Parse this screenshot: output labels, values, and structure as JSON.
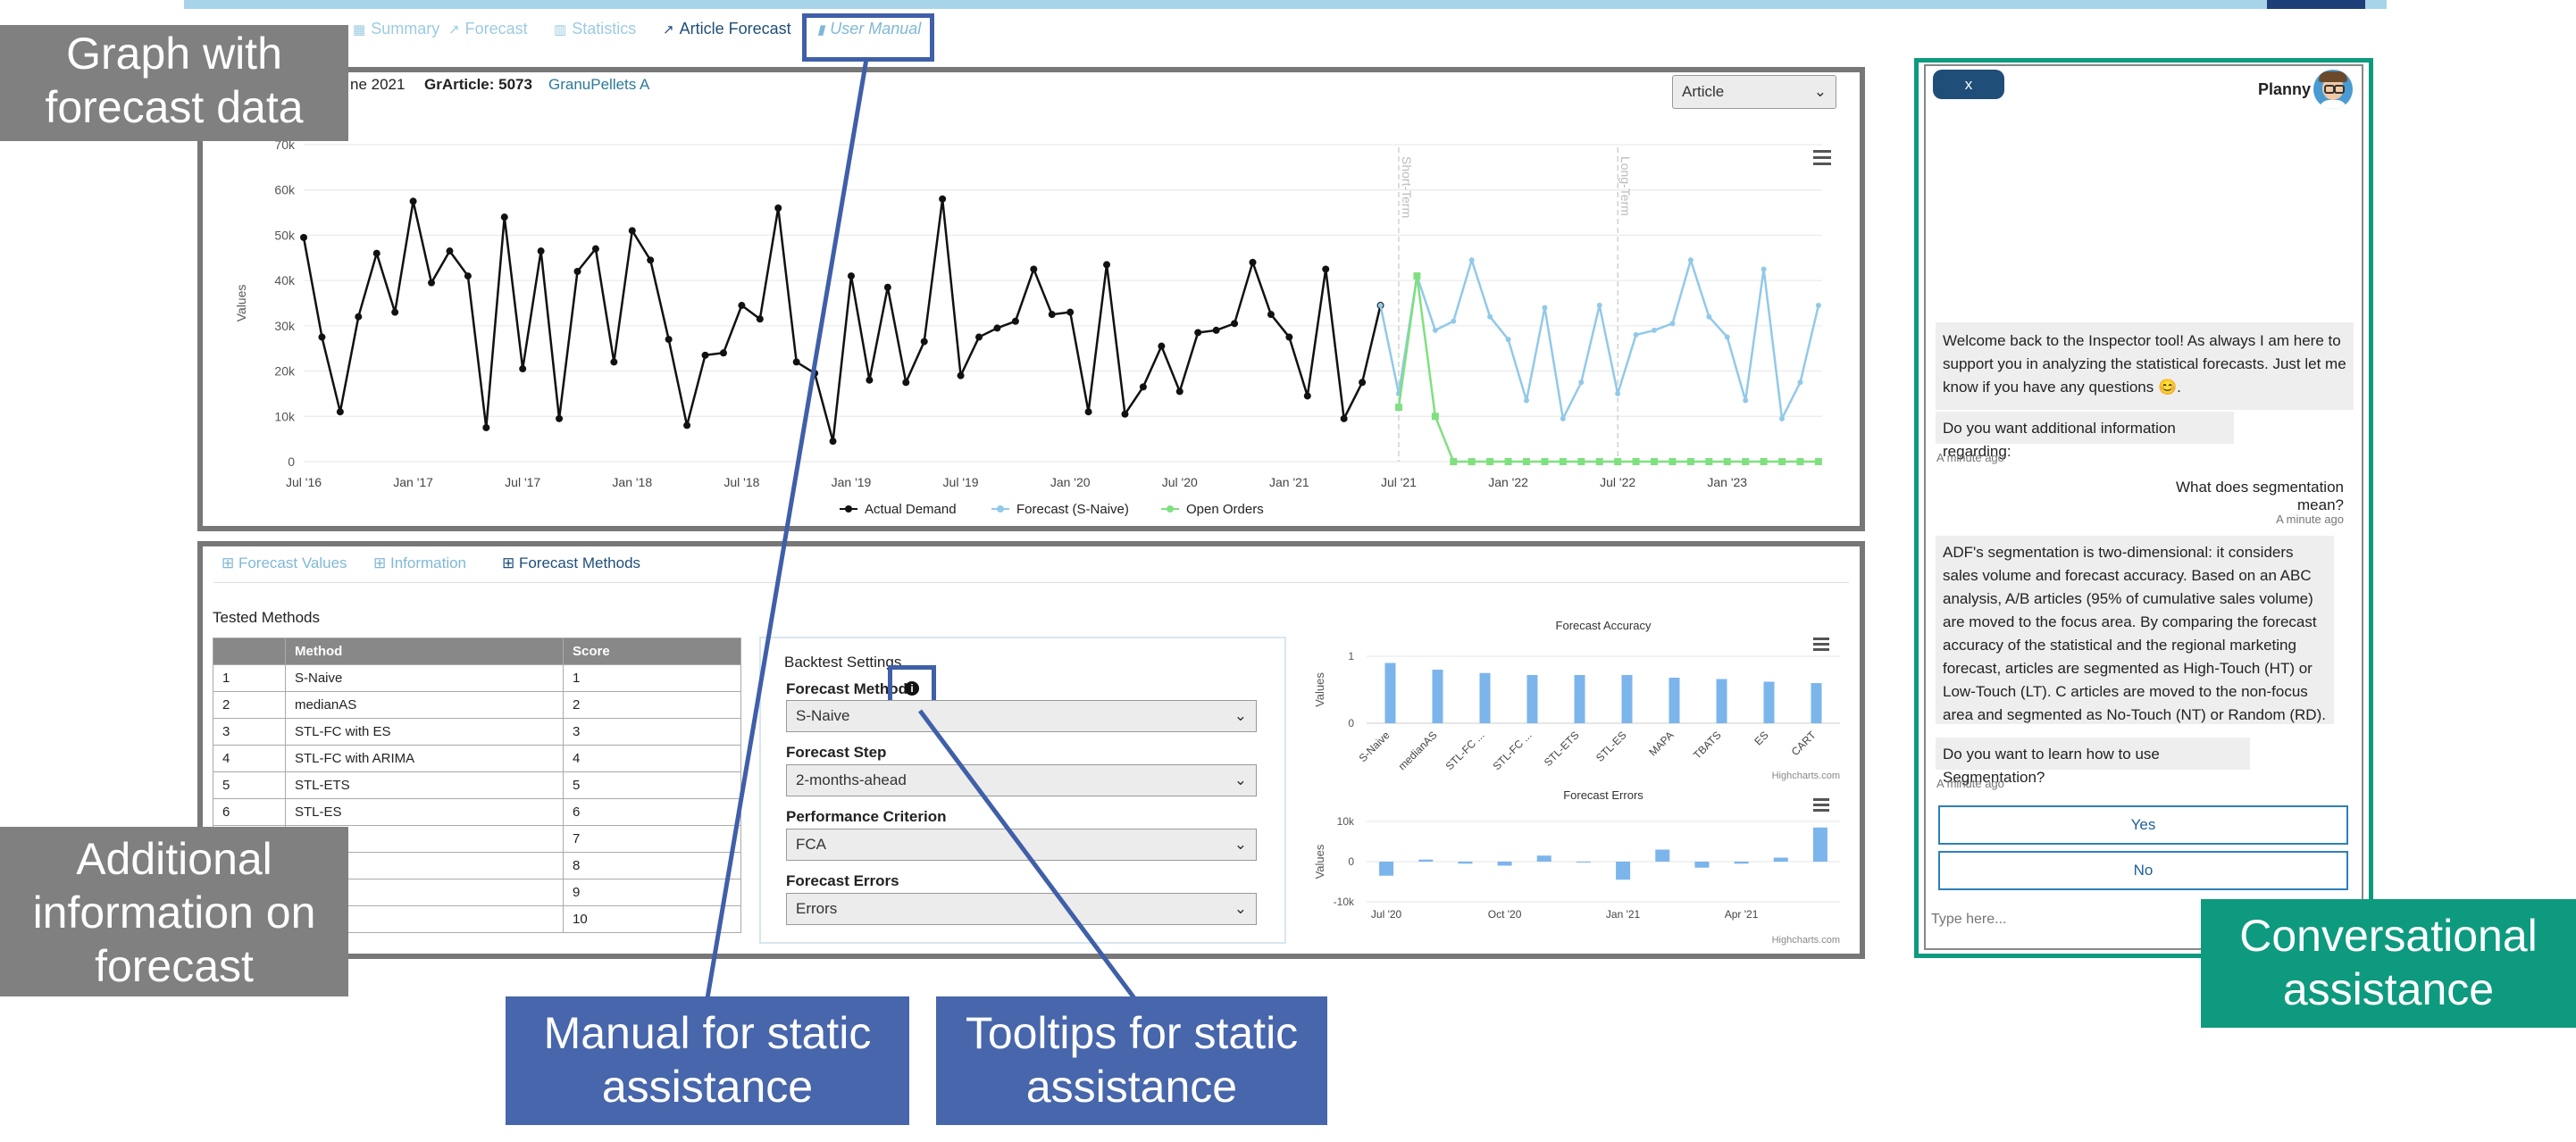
{
  "top_tabs": [
    {
      "label": "Summary",
      "icon": "home-icon"
    },
    {
      "label": "Forecast",
      "icon": "line-chart-icon"
    },
    {
      "label": "Statistics",
      "icon": "bar-chart-icon"
    },
    {
      "label": "Article Forecast",
      "icon": "line-chart-icon"
    },
    {
      "label": "User Manual",
      "icon": "book-icon"
    }
  ],
  "chart_header": {
    "date_fragment": "ne 2021",
    "article_label": "GrArticle: 5073",
    "article_name": "GranuPellets A",
    "level_select": "Article",
    "menu_icon": "hamburger-icon",
    "short_term_label": "Short-Term",
    "long_term_label": "Long-Term",
    "y_axis_label": "Values"
  },
  "chart_data": [
    {
      "type": "line",
      "y_axis_label": "Values",
      "y_ticks": [
        "0",
        "10k",
        "20k",
        "30k",
        "40k",
        "50k",
        "60k",
        "70k"
      ],
      "x_ticks": [
        "Jul '16",
        "Jan '17",
        "Jul '17",
        "Jan '18",
        "Jul '18",
        "Jan '19",
        "Jul '19",
        "Jan '20",
        "Jul '20",
        "Jan '21",
        "Jul '21",
        "Jan '22",
        "Jul '22",
        "Jan '23"
      ],
      "ylim": [
        0,
        70000
      ],
      "x_unit": "months since Jul 2016",
      "legend_position": "bottom-center",
      "series": [
        {
          "name": "Actual Demand",
          "color": "#111111",
          "x": [
            0,
            1,
            2,
            3,
            4,
            5,
            6,
            7,
            8,
            9,
            10,
            11,
            12,
            13,
            14,
            15,
            16,
            17,
            18,
            19,
            20,
            21,
            22,
            23,
            24,
            25,
            26,
            27,
            28,
            29,
            30,
            31,
            32,
            33,
            34,
            35,
            36,
            37,
            38,
            39,
            40,
            41,
            42,
            43,
            44,
            45,
            46,
            47,
            48,
            49,
            50,
            51,
            52,
            53,
            54,
            55,
            56,
            57,
            58,
            59
          ],
          "values": [
            49500,
            27500,
            11000,
            32000,
            46000,
            33000,
            57500,
            39500,
            46500,
            41000,
            7500,
            54000,
            20500,
            46500,
            9500,
            42000,
            47000,
            22000,
            51000,
            44500,
            27000,
            8000,
            23500,
            24000,
            34500,
            31500,
            56000,
            22000,
            19500,
            4500,
            41000,
            18000,
            38500,
            17500,
            26500,
            58000,
            19000,
            27500,
            29500,
            31000,
            42500,
            32500,
            33000,
            11000,
            43500,
            10500,
            16500,
            25500,
            15500,
            28500,
            29000,
            30500,
            44000,
            32500,
            27500,
            14500,
            42500,
            9500,
            17500,
            34500
          ]
        },
        {
          "name": "Forecast (S-Naive)",
          "color": "#92c9e8",
          "x": [
            59,
            60,
            61,
            62,
            63,
            64,
            65,
            66,
            67,
            68,
            69,
            70,
            71,
            72,
            73,
            74,
            75,
            76,
            77,
            78,
            79,
            80,
            81,
            82,
            83
          ],
          "values": [
            34500,
            15000,
            41000,
            29000,
            31000,
            44500,
            32000,
            27000,
            13500,
            34000,
            9500,
            17500,
            34500,
            15000,
            28000,
            29000,
            30500,
            44500,
            32000,
            27500,
            13500,
            42500,
            9500,
            17500,
            34500
          ]
        },
        {
          "name": "Open Orders",
          "color": "#7fe07f",
          "x": [
            60,
            61,
            62,
            63,
            64,
            65,
            66,
            67,
            68,
            69,
            70,
            71,
            72,
            73,
            74,
            75,
            76,
            77,
            78,
            79,
            80,
            81,
            82,
            83
          ],
          "values": [
            12000,
            41000,
            10000,
            0,
            0,
            0,
            0,
            0,
            0,
            0,
            0,
            0,
            0,
            0,
            0,
            0,
            0,
            0,
            0,
            0,
            0,
            0,
            0,
            0
          ]
        }
      ]
    },
    {
      "type": "bar",
      "title": "Forecast Accuracy",
      "y_axis_label": "Values",
      "y_ticks": [
        "0",
        "1"
      ],
      "categories": [
        "S-Naive",
        "medianAS",
        "STL-FC ...",
        "STL-FC ...",
        "STL-ETS",
        "STL-ES",
        "MAPA",
        "TBATS",
        "ES",
        "CART"
      ],
      "values": [
        0.9,
        0.8,
        0.75,
        0.72,
        0.72,
        0.72,
        0.68,
        0.66,
        0.62,
        0.6
      ],
      "ylim": [
        0,
        1
      ]
    },
    {
      "type": "bar",
      "title": "Forecast Errors",
      "y_axis_label": "Values",
      "y_ticks": [
        "10k",
        "0",
        "-10k"
      ],
      "x_ticks": [
        "Jul '20",
        "Oct '20",
        "Jan '21",
        "Apr '21"
      ],
      "x": [
        0,
        1,
        2,
        3,
        4,
        5,
        6,
        7,
        8,
        9,
        10,
        11
      ],
      "values": [
        -3500,
        500,
        -500,
        -1000,
        1500,
        0,
        -4500,
        3000,
        -1500,
        -500,
        1000,
        8500
      ],
      "ylim": [
        -10000,
        10000
      ]
    }
  ],
  "chart_legend": [
    {
      "label": "Actual Demand",
      "color": "#111111"
    },
    {
      "label": "Forecast (S-Naive)",
      "color": "#92c9e8"
    },
    {
      "label": "Open Orders",
      "color": "#7fe07f"
    }
  ],
  "credit": "Highcharts.com",
  "bottom_tabs": [
    {
      "label": "Forecast Values",
      "icon": "table-icon"
    },
    {
      "label": "Information",
      "icon": "table-icon"
    },
    {
      "label": "Forecast Methods",
      "icon": "table-icon"
    }
  ],
  "tested_methods": {
    "title": "Tested Methods",
    "headers": [
      "",
      "Method",
      "Score"
    ],
    "rows": [
      [
        "1",
        "S-Naive",
        "1"
      ],
      [
        "2",
        "medianAS",
        "2"
      ],
      [
        "3",
        "STL-FC with ES",
        "3"
      ],
      [
        "4",
        "STL-FC with ARIMA",
        "4"
      ],
      [
        "5",
        "STL-ETS",
        "5"
      ],
      [
        "6",
        "STL-ES",
        "6"
      ],
      [
        "",
        "",
        "7"
      ],
      [
        "",
        "",
        "8"
      ],
      [
        "",
        "",
        "9"
      ],
      [
        "",
        "",
        "10"
      ]
    ]
  },
  "backtest": {
    "title": "Backtest Settings",
    "method_label": "Forecast Method",
    "method_value": "S-Naive",
    "step_label": "Forecast Step",
    "step_value": "2-months-ahead",
    "criterion_label": "Performance Criterion",
    "criterion_value": "FCA",
    "errors_label": "Forecast Errors",
    "errors_value": "Errors",
    "info_icon": "info-circle-icon"
  },
  "chat": {
    "close_label": "x",
    "bot_name": "Planny",
    "avatar_icon": "avatar-icon",
    "messages": [
      {
        "from": "bot",
        "text": "Welcome back to the Inspector tool! As always I am here to support you in analyzing the statistical forecasts. Just let me know if you have any questions 😊."
      },
      {
        "from": "bot",
        "text": "Do you want additional information regarding:"
      },
      {
        "from": "time",
        "text": "A minute ago"
      },
      {
        "from": "user",
        "text": "What does segmentation mean?"
      },
      {
        "from": "time",
        "text": "A minute ago"
      },
      {
        "from": "bot",
        "text": "ADF's segmentation is two-dimensional: it considers sales volume and forecast accuracy. Based on an ABC analysis, A/B articles (95% of cumulative sales volume) are moved to the focus area. By comparing the forecast accuracy of the statistical and the regional marketing forecast, articles are segmented as High-Touch (HT) or Low-Touch (LT). C articles are moved to the non-focus area and segmented as No-Touch (NT) or Random (RD)."
      },
      {
        "from": "bot",
        "text": "Do you want to learn how to use Segmentation?"
      },
      {
        "from": "time",
        "text": "A minute ago"
      }
    ],
    "yes_label": "Yes",
    "no_label": "No",
    "input_placeholder": "Type here..."
  },
  "callouts": {
    "graph": "Graph with forecast data",
    "additional": "Additional information on forecast",
    "manual": "Manual for static assistance",
    "tooltips": "Tooltips for static assistance",
    "conversational": "Conversational assistance"
  },
  "colors": {
    "callout_gray": "#808080",
    "callout_blue": "#4766ab",
    "callout_teal": "#0e9a7e",
    "link_blue": "#1f4e79",
    "bar_blue": "#7cb5ec"
  }
}
